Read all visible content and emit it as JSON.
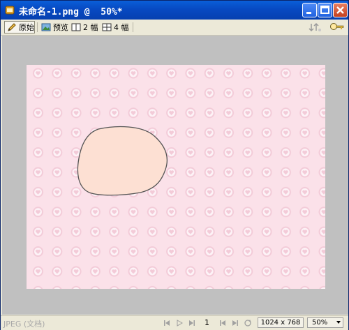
{
  "window": {
    "title": "未命名-1.png @  50%*",
    "controls": [
      "minimize-icon",
      "maximize-icon",
      "close-icon"
    ]
  },
  "toolbar": {
    "tabs": [
      {
        "label": "原始",
        "icon": "pencil-icon",
        "active": true
      },
      {
        "label": "预览",
        "icon": "image-icon",
        "active": false
      },
      {
        "label": "2 幅",
        "icon": "two-pane-icon",
        "active": false
      },
      {
        "label": "4 幅",
        "icon": "four-pane-icon",
        "active": false
      }
    ],
    "right_icons": [
      "quick-export-icon",
      "magnifier-key-icon"
    ]
  },
  "canvas": {
    "background_color": "#c0c0c0",
    "document_color": "#fbe1e9",
    "pattern_icon": "heart-circle-icon",
    "shape_fill": "#fde0d3",
    "shape_stroke": "#555555"
  },
  "status": {
    "format": "JPEG (文档)",
    "page": "1",
    "dimensions": "1024 x 768",
    "zoom": "50%",
    "nav_icons": [
      "first-frame-icon",
      "play-icon",
      "last-frame-icon",
      "prev-frame-icon",
      "next-frame-icon",
      "loop-icon"
    ]
  }
}
